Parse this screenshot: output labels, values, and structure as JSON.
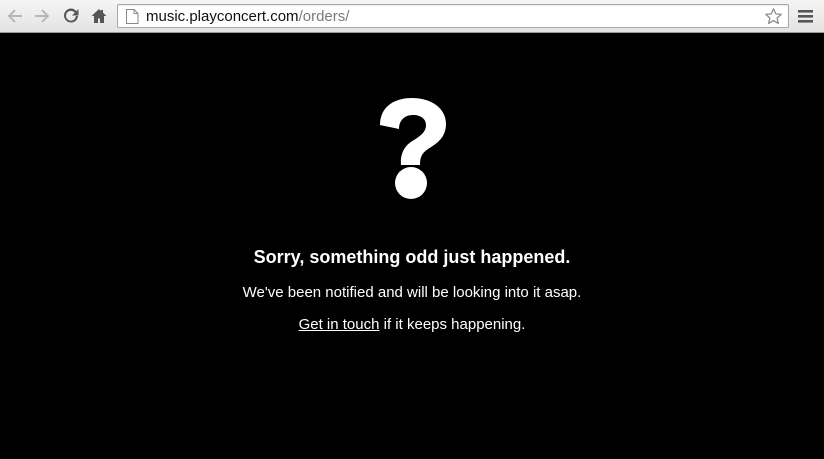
{
  "browser": {
    "address_bar": {
      "host": "music.playconcert.com",
      "path": "/orders/"
    }
  },
  "error_page": {
    "heading": "Sorry, something odd just happened.",
    "notice": "We've been notified and will be looking into it asap.",
    "contact_link": "Get in touch",
    "contact_suffix": " if it keeps happening.",
    "icon": "question-mark-icon"
  },
  "colors": {
    "page_background": "#000000",
    "text": "#ffffff",
    "toolbar": "#e8e8e8"
  }
}
